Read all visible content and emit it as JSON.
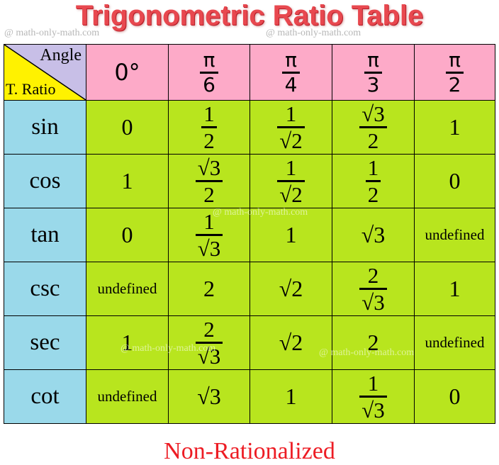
{
  "title": "Trigonometric Ratio Table",
  "watermark": "@ math-only-math.com",
  "corner": {
    "top_label": "Angle",
    "bottom_label": "T. Ratio"
  },
  "angles": [
    {
      "type": "text",
      "text": "0°"
    },
    {
      "type": "frac",
      "num": "π",
      "den": "6"
    },
    {
      "type": "frac",
      "num": "π",
      "den": "4"
    },
    {
      "type": "frac",
      "num": "π",
      "den": "3"
    },
    {
      "type": "frac",
      "num": "π",
      "den": "2"
    }
  ],
  "rows": [
    {
      "ratio": "sin",
      "values": [
        {
          "type": "text",
          "text": "0"
        },
        {
          "type": "frac",
          "num": "1",
          "den": "2"
        },
        {
          "type": "frac",
          "num": "1",
          "den": "√2"
        },
        {
          "type": "frac",
          "num": "√3",
          "den": "2"
        },
        {
          "type": "text",
          "text": "1"
        }
      ]
    },
    {
      "ratio": "cos",
      "values": [
        {
          "type": "text",
          "text": "1"
        },
        {
          "type": "frac",
          "num": "√3",
          "den": "2"
        },
        {
          "type": "frac",
          "num": "1",
          "den": "√2"
        },
        {
          "type": "frac",
          "num": "1",
          "den": "2"
        },
        {
          "type": "text",
          "text": "0"
        }
      ]
    },
    {
      "ratio": "tan",
      "values": [
        {
          "type": "text",
          "text": "0"
        },
        {
          "type": "frac",
          "num": "1",
          "den": "√3"
        },
        {
          "type": "text",
          "text": "1"
        },
        {
          "type": "text",
          "text": "√3"
        },
        {
          "type": "undef",
          "text": "undefined"
        }
      ]
    },
    {
      "ratio": "csc",
      "values": [
        {
          "type": "undef",
          "text": "undefined"
        },
        {
          "type": "text",
          "text": "2"
        },
        {
          "type": "text",
          "text": "√2"
        },
        {
          "type": "frac",
          "num": "2",
          "den": "√3"
        },
        {
          "type": "text",
          "text": "1"
        }
      ]
    },
    {
      "ratio": "sec",
      "values": [
        {
          "type": "text",
          "text": "1"
        },
        {
          "type": "frac",
          "num": "2",
          "den": "√3"
        },
        {
          "type": "text",
          "text": "√2"
        },
        {
          "type": "text",
          "text": "2"
        },
        {
          "type": "undef",
          "text": "undefined"
        }
      ]
    },
    {
      "ratio": "cot",
      "values": [
        {
          "type": "undef",
          "text": "undefined"
        },
        {
          "type": "text",
          "text": "√3"
        },
        {
          "type": "text",
          "text": "1"
        },
        {
          "type": "frac",
          "num": "1",
          "den": "√3"
        },
        {
          "type": "text",
          "text": "0"
        }
      ]
    }
  ],
  "footer": "Non-Rationalized",
  "colors": {
    "title": "#e8484f",
    "header_bg": "#fdaac8",
    "corner_top_bg": "#c8bfe7",
    "corner_bottom_bg": "#fff200",
    "ratio_bg": "#9ad9ea",
    "value_bg": "#b8e51e",
    "footer": "#ed1c24"
  }
}
